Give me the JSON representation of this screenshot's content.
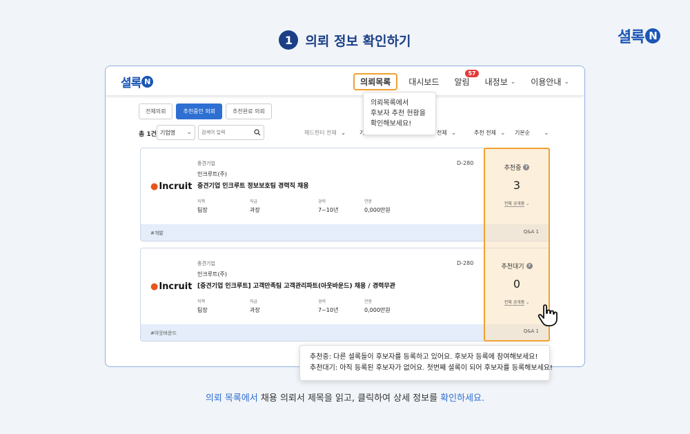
{
  "brand": {
    "text": "셜록",
    "mark": "N"
  },
  "step": {
    "number": "1",
    "title": "의뢰 정보 확인하기"
  },
  "app": {
    "logo_text": "셜록",
    "logo_mark": "N",
    "nav": [
      {
        "label": "의뢰목록"
      },
      {
        "label": "대시보드"
      },
      {
        "label": "알림",
        "badge": "57"
      },
      {
        "label": "내정보"
      },
      {
        "label": "이용안내"
      }
    ],
    "tooltip_nav": [
      "의뢰목록에서",
      "후보자 추천 현황을",
      "확인해보세요!"
    ],
    "tabs": [
      "전체의뢰",
      "추천중인 의뢰",
      "추천완료 의뢰"
    ],
    "filters": {
      "total": "총 1건",
      "company_type": "기업명",
      "search_placeholder": "검색어 입력",
      "headhunter": "헤드헌터 전체",
      "mid_fragment": "기",
      "all": "전체",
      "recommend": "추천 전체",
      "sort": "기본순"
    },
    "cards": [
      {
        "type": "중견기업",
        "company": "인크루트(주)",
        "title": "중견기업 인크루트 정보보호팀 경력직 채용",
        "dday": "D-280",
        "logo": "Incruit",
        "meta_labels": [
          "직책",
          "직급",
          "경력",
          "연봉"
        ],
        "meta_values": [
          "팀장",
          "과장",
          "7~10년",
          "0,000만원"
        ],
        "tag": "#개발",
        "qa": "Q&A 1",
        "status_label": "추천중",
        "status_count": "3",
        "status_link": "전체 공개중"
      },
      {
        "type": "중견기업",
        "company": "인크루트(주)",
        "title": "[중견기업 인크루트] 고객만족팀 고객관리파트(아웃바운드) 채용 / 경력무관",
        "dday": "D-280",
        "logo": "Incruit",
        "meta_labels": [
          "직책",
          "직급",
          "경력",
          "연봉"
        ],
        "meta_values": [
          "팀장",
          "과장",
          "7~10년",
          "0,000만원"
        ],
        "tag": "#아웃바운드",
        "qa": "Q&A 1",
        "status_label": "추천대기",
        "status_count": "0",
        "status_link": "전체 공개중"
      }
    ],
    "tooltip_status": [
      "추천중: 다른 셜록들이 후보자를 등록하고 있어요. 후보자 등록에 참여해보세요!",
      "추천대기: 아직 등록된 후보자가 없어요. 첫번째 셜록이 되어 후보자를 등록해보세요!"
    ]
  },
  "caption": {
    "part1": "의뢰 목록에서",
    "part2": " 채용 의뢰서 제목을 읽고, 클릭하여 상세 정보를 ",
    "part3": "확인하세요."
  }
}
